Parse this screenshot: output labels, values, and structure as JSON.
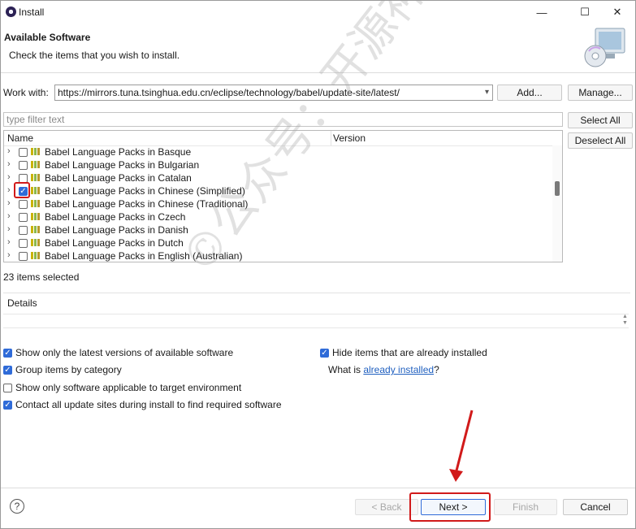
{
  "window": {
    "title": "Install",
    "minimize_glyph": "—",
    "maximize_glyph": "☐",
    "close_glyph": "✕"
  },
  "header": {
    "title": "Available Software",
    "subtitle": "Check the items that you wish to install.",
    "icon": "cd-computer-icon"
  },
  "work_with": {
    "label": "Work with:",
    "value": "https://mirrors.tuna.tsinghua.edu.cn/eclipse/technology/babel/update-site/latest/",
    "add_label": "Add...",
    "manage_label": "Manage..."
  },
  "filter": {
    "placeholder": "type filter text"
  },
  "side_buttons": {
    "select_all": "Select All",
    "deselect_all": "Deselect All"
  },
  "tree": {
    "columns": [
      "Name",
      "Version"
    ],
    "rows": [
      {
        "label": "Babel Language Packs in Basque",
        "checked": false
      },
      {
        "label": "Babel Language Packs in Bulgarian",
        "checked": false
      },
      {
        "label": "Babel Language Packs in Catalan",
        "checked": false
      },
      {
        "label": "Babel Language Packs in Chinese (Simplified)",
        "checked": true
      },
      {
        "label": "Babel Language Packs in Chinese (Traditional)",
        "checked": false
      },
      {
        "label": "Babel Language Packs in Czech",
        "checked": false
      },
      {
        "label": "Babel Language Packs in Danish",
        "checked": false
      },
      {
        "label": "Babel Language Packs in Dutch",
        "checked": false
      },
      {
        "label": "Babel Language Packs in English (Australian)",
        "checked": false
      }
    ]
  },
  "status": {
    "selected_text": "23 items selected"
  },
  "details": {
    "label": "Details"
  },
  "options": {
    "show_latest": {
      "label": "Show only the latest versions of available software",
      "checked": true
    },
    "group_by_category": {
      "label": "Group items by category",
      "checked": true
    },
    "show_applicable": {
      "label": "Show only software applicable to target environment",
      "checked": false
    },
    "contact_sites": {
      "label": "Contact all update sites during install to find required software",
      "checked": true
    },
    "hide_installed": {
      "label": "Hide items that are already installed",
      "checked": true
    },
    "what_is_prefix": "What is ",
    "what_is_link": "already installed",
    "what_is_suffix": "?"
  },
  "footer": {
    "help_glyph": "?",
    "back_label": "< Back",
    "next_label": "Next >",
    "finish_label": "Finish",
    "cancel_label": "Cancel"
  },
  "watermark": {
    "text": "©公众号：开源神器"
  },
  "colors": {
    "accent": "#2f6bd8",
    "annotation_red": "#d11a1a",
    "link": "#1f5fbf"
  }
}
